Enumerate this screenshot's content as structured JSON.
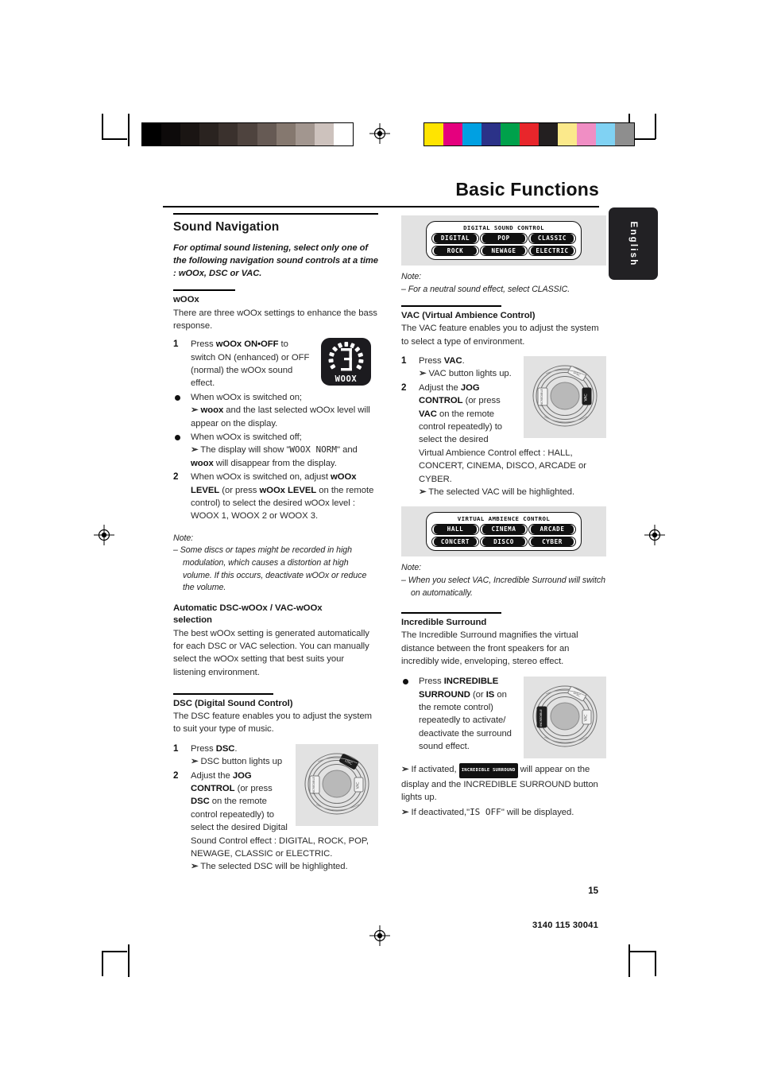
{
  "document": {
    "title": "Basic Functions",
    "language_tab": "English",
    "page_number": "15",
    "doc_code": "3140 115 30041"
  },
  "print_marks": {
    "gray_ramp": [
      "#000000",
      "#0d0a0a",
      "#1a1513",
      "#2a2320",
      "#3a312d",
      "#4e433e",
      "#665a54",
      "#85786f",
      "#a2968f",
      "#cdc2bd",
      "#ffffff"
    ],
    "color_patches": [
      "#ffe400",
      "#e5007e",
      "#00a0e2",
      "#2b3288",
      "#00a14b",
      "#e8262b",
      "#231f20",
      "#fbe98b",
      "#f08ec4",
      "#80d2f3",
      "#8e8e8e"
    ]
  },
  "left_column": {
    "section_title": "Sound Navigation",
    "lead": "For optimal sound listening, select only one of the following navigation sound controls at a time : wOOx, DSC or VAC.",
    "woox": {
      "heading": "wOOx",
      "intro": "There are three wOOx settings to enhance the bass response.",
      "badge_label": "WOOX",
      "steps": [
        {
          "num": "1",
          "html": "Press <b>wOOx ON&bull;OFF</b> to switch ON (enhanced) or OFF (normal) the wOOx sound effect."
        },
        {
          "bullet": true,
          "html": "When wOOx is switched on;<br><span class=\"arrow\">&#10146;</span> <b>woox</b> and the last selected wOOx level will appear on the display."
        },
        {
          "bullet": true,
          "html": "When wOOx is switched off;<br><span class=\"arrow\">&#10146;</span> The display will show \"<span class=\"seg\">WOOX NORM</span>\" and <b>woox</b> will disappear from the display."
        },
        {
          "num": "2",
          "html": "When wOOx is switched on, adjust <b>wOOx LEVEL</b> (or press <b>wOOx LEVEL</b> on the remote control) to select the desired wOOx level : WOOX 1, WOOX 2 or WOOX 3."
        }
      ],
      "note_label": "Note:",
      "note_text": "–  Some discs or tapes might be recorded in high modulation, which causes a distortion at high volume. If this occurs, deactivate wOOx or reduce the volume."
    },
    "auto_selection": {
      "heading_line1": "Automatic DSC-wOOx / VAC-wOOx",
      "heading_line2": "selection",
      "body": "The best wOOx setting is generated automatically for each DSC or VAC selection. You can manually select the wOOx setting that best suits your listening environment."
    },
    "dsc": {
      "heading": "DSC (Digital Sound Control)",
      "intro": "The DSC feature enables you to adjust the system to suit your type of music.",
      "steps": [
        {
          "num": "1",
          "html": "Press <b>DSC</b>.<br><span class=\"arrow\">&#10146;</span> DSC button lights up"
        },
        {
          "num": "2",
          "html": "Adjust the <b>JOG CONTROL</b> (or press <b>DSC</b> on the remote control repeatedly) to select the desired Digital Sound Control effect : DIGITAL, ROCK, POP, NEWAGE, CLASSIC or ELECTRIC.<br><span class=\"arrow\">&#10146;</span> The selected DSC will be highlighted."
        }
      ],
      "figure_name": "jog-control-dsc"
    }
  },
  "right_column": {
    "dsc_display": {
      "title": "DIGITAL SOUND CONTROL",
      "row1": [
        "DIGITAL",
        "POP",
        "CLASSIC"
      ],
      "row2": [
        "ROCK",
        "NEWAGE",
        "ELECTRIC"
      ]
    },
    "dsc_note_label": "Note:",
    "dsc_note_text": "–  For a neutral sound effect, select CLASSIC.",
    "vac": {
      "heading": "VAC (Virtual Ambience Control)",
      "intro": "The VAC feature enables you to adjust the system to select a type of environment.",
      "steps": [
        {
          "num": "1",
          "html": "Press <b>VAC</b>.<br><span class=\"arrow\">&#10146;</span> VAC button lights up."
        },
        {
          "num": "2",
          "html": "Adjust the <b>JOG CONTROL</b> (or press <b>VAC</b> on the remote control repeatedly) to select the desired Virtual Ambience Control effect : HALL, CONCERT, CINEMA, DISCO, ARCADE or CYBER.<br><span class=\"arrow\">&#10146;</span> The selected VAC will be highlighted."
        }
      ],
      "figure_name": "jog-control-vac",
      "display": {
        "title": "VIRTUAL AMBIENCE CONTROL",
        "row1": [
          "HALL",
          "CINEMA",
          "ARCADE"
        ],
        "row2": [
          "CONCERT",
          "DISCO",
          "CYBER"
        ]
      },
      "note_label": "Note:",
      "note_text": "–  When you select VAC, Incredible Surround will switch on automatically."
    },
    "incredible_surround": {
      "heading": "Incredible Surround",
      "intro": "The Incredible Surround magnifies the virtual distance between the front speakers for an incredibly wide, enveloping, stereo effect.",
      "step_html": "Press <b>INCREDIBLE SURROUND</b> (or <b>IS</b> on the remote control) repeatedly to activate/ deactivate the surround sound effect.",
      "activated_html": "<span class=\"arrow\">&#10146;</span> If activated, <span class=\"lcd-inline\">INCREDIBLE SURROUND</span> will appear on the display and the INCREDIBLE SURROUND button lights up.",
      "deactivated_html": "<span class=\"arrow\">&#10146;</span> If deactivated,\"<span class=\"seg\">IS OFF</span>\" will be displayed.",
      "badge_label": "INCREDIBLE SURROUND",
      "figure_name": "jog-control-incredible-surround"
    }
  }
}
